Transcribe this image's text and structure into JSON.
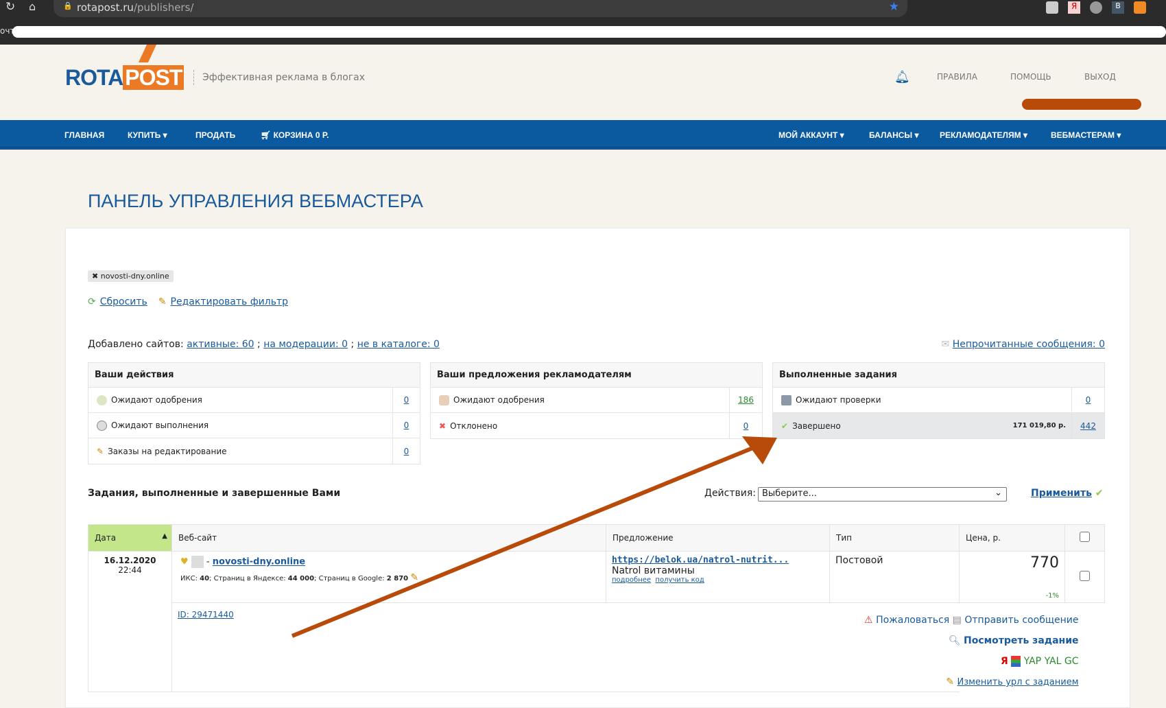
{
  "browser": {
    "url_host": "rotapost.ru",
    "url_path": "/publishers/",
    "bookmark_partial": "очт"
  },
  "header": {
    "logo_left": "ROTA",
    "logo_right": "POST",
    "tagline": "Эффективная реклама в блогах",
    "links": [
      "ПРАВИЛА",
      "ПОМОЩЬ",
      "ВЫХОД"
    ]
  },
  "nav": {
    "left": [
      "ГЛАВНАЯ",
      "КУПИТЬ",
      "ПРОДАТЬ",
      "КОРЗИНА 0 Р."
    ],
    "right": [
      "МОЙ АККАУНТ",
      "БАЛАНСЫ",
      "РЕКЛАМОДАТЕЛЯМ",
      "ВЕБМАСТЕРАМ"
    ]
  },
  "page_title": "ПАНЕЛЬ УПРАВЛЕНИЯ ВЕБМАСТЕРА",
  "filter": {
    "tag": "novosti-dny.online",
    "reset": "Сбросить",
    "edit": "Редактировать фильтр"
  },
  "sites": {
    "label": "Добавлено сайтов:",
    "active": "активные: 60",
    "moderation": "на модерации: 0",
    "not_in_catalog": "не в каталоге: 0",
    "unread": "Непрочитанные сообщения: 0"
  },
  "boxes": [
    {
      "title": "Ваши действия",
      "rows": [
        {
          "label": "Ожидают одобрения",
          "value": "0"
        },
        {
          "label": "Ожидают выполнения",
          "value": "0"
        },
        {
          "label": "Заказы на редактирование",
          "value": "0"
        }
      ]
    },
    {
      "title": "Ваши предложения рекламодателям",
      "rows": [
        {
          "label": "Ожидают одобрения",
          "value": "186"
        },
        {
          "label": "Отклонено",
          "value": "0"
        }
      ]
    },
    {
      "title": "Выполненные задания",
      "rows": [
        {
          "label": "Ожидают проверки",
          "value": "0",
          "sum": ""
        },
        {
          "label": "Завершено",
          "value": "442",
          "sum": "171 019,80 р."
        }
      ]
    }
  ],
  "tasks": {
    "title": "Задания, выполненные и завершенные Вами",
    "actions_label": "Действия:",
    "select_value": "Выберите...",
    "apply": "Применить",
    "columns": [
      "Дата",
      "Веб-сайт",
      "Предложение",
      "Тип",
      "Цена, р."
    ],
    "row": {
      "date": "16.12.2020",
      "time": "22:44",
      "site": "novosti-dny.online",
      "stats_iks_l": "ИКС: ",
      "iks": "40",
      "stats_y_l": "; Страниц в Яндексе: ",
      "yandex": "44 000",
      "stats_g_l": "; Страниц в Google: ",
      "google": "2 870",
      "offer_url": "https://belok.ua/natrol-nutrit...",
      "offer_name": "Natrol витамины",
      "more": "подробнее",
      "get_code": "получить код",
      "type": "Постовой",
      "price": "770",
      "discount": "-1%",
      "id": "ID: 29471440",
      "complain": "Пожаловаться",
      "send_message": "Отправить сообщение",
      "view_task": "Посмотреть задание",
      "yandex_icon": "Я",
      "codes": "YAP YAL GC",
      "change_url": "Изменить урл с заданием"
    }
  },
  "colors": {
    "brand_blue": "#0b5aa0",
    "logo_orange": "#ec7a25",
    "arrow": "#b84a0a",
    "sort_green": "#c3e68a"
  }
}
